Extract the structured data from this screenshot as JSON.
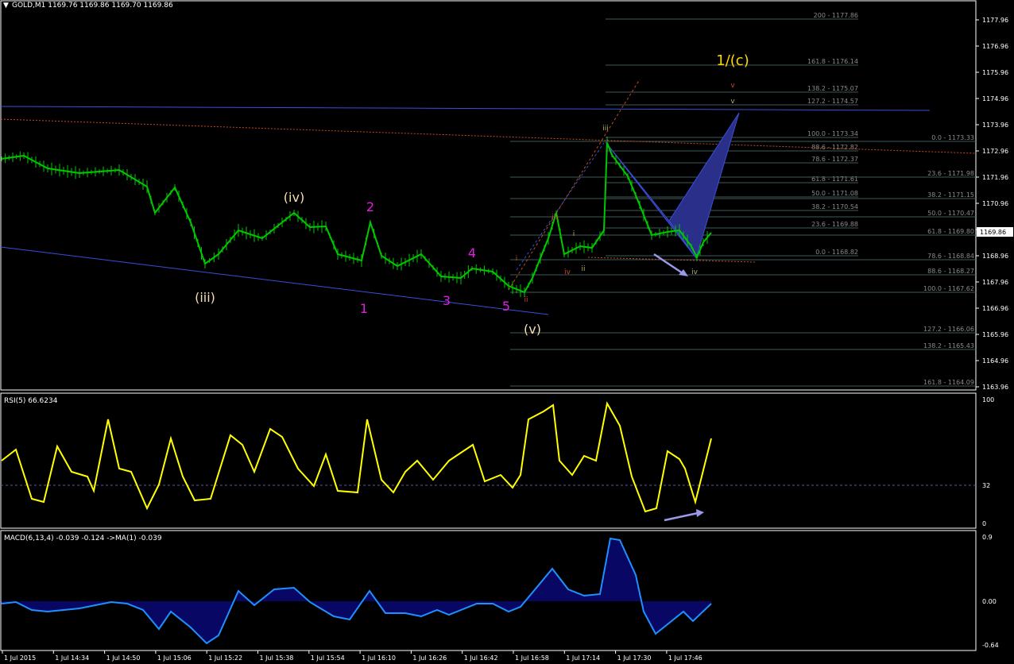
{
  "window_title": "GOLD,M1  1169.76 1169.86 1169.70 1169.86",
  "price_scale": [
    "1177.96",
    "1176.96",
    "1175.96",
    "1174.96",
    "1173.96",
    "1172.96",
    "1171.96",
    "1170.96",
    "1169.96",
    "1168.96",
    "1167.96",
    "1166.96",
    "1165.96",
    "1164.96",
    "1163.96"
  ],
  "current_price": "1169.86",
  "rsi": {
    "title": "RSI(5) 66.6234",
    "levels": [
      "100",
      "32",
      "0"
    ]
  },
  "macd": {
    "title": "MACD(6,13,4) -0.039 -0.124  ->MA(1) -0.039",
    "levels": [
      "0.9",
      "0.00",
      "-0.64"
    ]
  },
  "time_axis": [
    "1 Jul 2015",
    "1 Jul 14:34",
    "1 Jul 14:50",
    "1 Jul 15:06",
    "1 Jul 15:22",
    "1 Jul 15:38",
    "1 Jul 15:54",
    "1 Jul 16:10",
    "1 Jul 16:26",
    "1 Jul 16:42",
    "1 Jul 16:58",
    "1 Jul 17:14",
    "1 Jul 17:30",
    "1 Jul 17:46"
  ],
  "fib_levels_right": [
    "200 - 1177.86",
    "161.8 - 1176.14",
    "138.2 - 1175.07",
    "127.2 - 1174.57",
    "100.0 - 1173.34",
    "88.6 - 1172.82",
    "78.6 - 1172.37",
    "61.8 - 1171.61",
    "50.0 - 1171.08",
    "38.2 - 1170.54",
    "23.6 - 1169.88",
    "0.0 - 1168.82"
  ],
  "fib_levels_far": [
    "0.0 - 1173.33",
    "23.6 - 1171.98",
    "38.2 - 1171.15",
    "50.0 - 1170.47",
    "61.8 - 1169.80",
    "78.6 - 1168.84",
    "88.6 - 1168.27",
    "100.0 - 1167.62",
    "127.2 - 1166.06",
    "138.2 - 1165.43",
    "161.8 - 1164.09"
  ],
  "wave_labels": {
    "iii_paren": "(iii)",
    "iv_paren": "(iv)",
    "v_paren": "(v)",
    "w1": "1",
    "w2": "2",
    "w3": "3",
    "w4": "4",
    "w5": "5",
    "c_label": "1/(c)",
    "sm_i": "i",
    "sm_ii": "ii",
    "sm_iii": "iii",
    "sm_iv": "iv",
    "g_i": "i",
    "g_ii": "ii",
    "g_iii": "iii",
    "g_iv": "iv",
    "g_v": "v",
    "r_v": "v"
  },
  "colors": {
    "candle": "#00c800",
    "rsi": "#ffff00",
    "macd": "#1e90ff",
    "pattern": "#2a2f8a",
    "wave_magenta": "#e020e0",
    "wave_cream": "#f5deb3",
    "wave_yellow": "#ffd700"
  }
}
